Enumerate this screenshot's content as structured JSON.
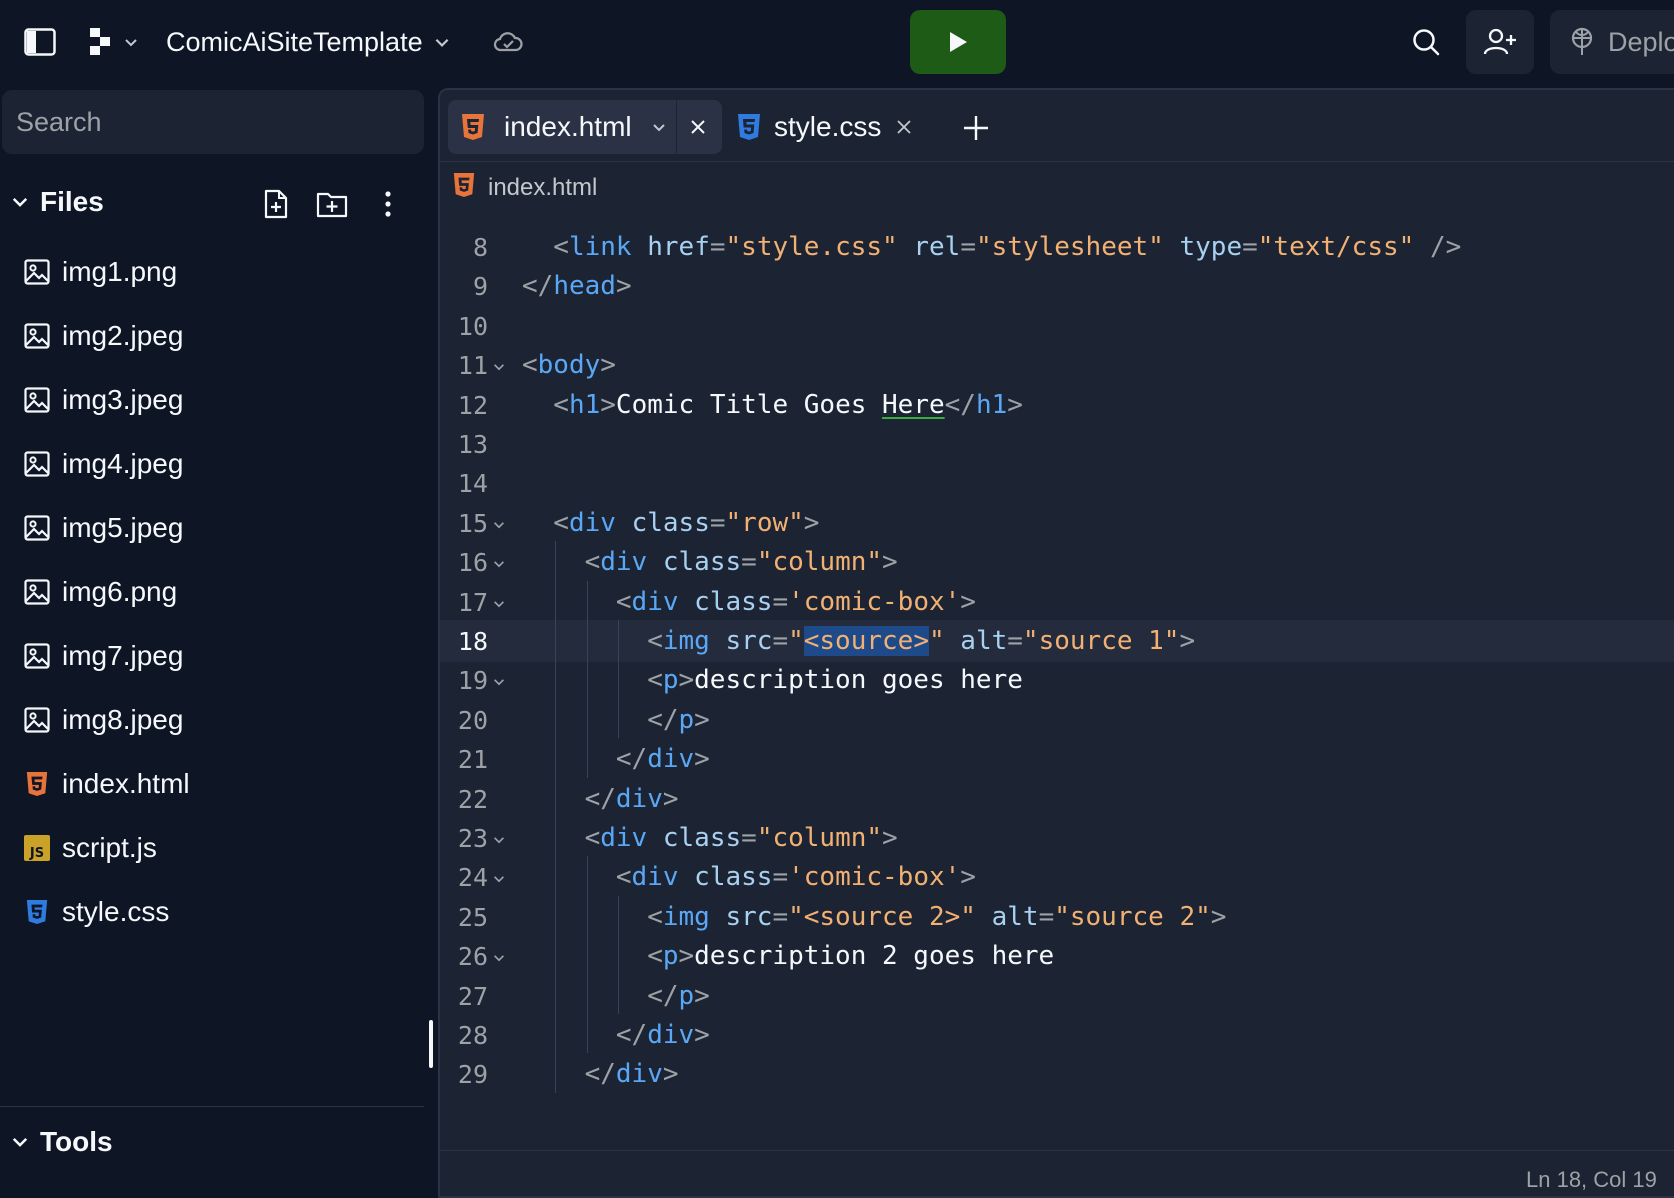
{
  "topbar": {
    "repl_name": "ComicAiSiteTemplate",
    "deploy_label": "Deploy"
  },
  "sidebar": {
    "search_placeholder": "Search",
    "files_title": "Files",
    "files": [
      {
        "name": "img1.png",
        "icon": "image-icon"
      },
      {
        "name": "img2.jpeg",
        "icon": "image-icon"
      },
      {
        "name": "img3.jpeg",
        "icon": "image-icon"
      },
      {
        "name": "img4.jpeg",
        "icon": "image-icon"
      },
      {
        "name": "img5.jpeg",
        "icon": "image-icon"
      },
      {
        "name": "img6.png",
        "icon": "image-icon"
      },
      {
        "name": "img7.jpeg",
        "icon": "image-icon"
      },
      {
        "name": "img8.jpeg",
        "icon": "image-icon"
      },
      {
        "name": "index.html",
        "icon": "html5-icon"
      },
      {
        "name": "script.js",
        "icon": "js-icon"
      },
      {
        "name": "style.css",
        "icon": "css3-icon"
      }
    ],
    "tools_title": "Tools"
  },
  "editor": {
    "tabs": [
      {
        "label": "index.html",
        "icon": "html5-icon",
        "active": true
      },
      {
        "label": "style.css",
        "icon": "css3-icon",
        "active": false
      }
    ],
    "filepath": "index.html",
    "current_line": 18,
    "code_lines": [
      {
        "n": "8",
        "fold": false,
        "indent": 1,
        "tokens": [
          [
            "br",
            "<"
          ],
          [
            "tag",
            "link"
          ],
          [
            "txt",
            " "
          ],
          [
            "attr",
            "href"
          ],
          [
            "br",
            "="
          ],
          [
            "str",
            "\"style.css\""
          ],
          [
            "txt",
            " "
          ],
          [
            "attr",
            "rel"
          ],
          [
            "br",
            "="
          ],
          [
            "str",
            "\"stylesheet\""
          ],
          [
            "txt",
            " "
          ],
          [
            "attr",
            "type"
          ],
          [
            "br",
            "="
          ],
          [
            "str",
            "\"text/css\""
          ],
          [
            "txt",
            " "
          ],
          [
            "br",
            "/>"
          ]
        ]
      },
      {
        "n": "9",
        "fold": false,
        "indent": 0,
        "tokens": [
          [
            "br",
            "</"
          ],
          [
            "tag",
            "head"
          ],
          [
            "br",
            ">"
          ]
        ]
      },
      {
        "n": "10",
        "fold": false,
        "indent": 0,
        "tokens": []
      },
      {
        "n": "11",
        "fold": true,
        "indent": 0,
        "tokens": [
          [
            "br",
            "<"
          ],
          [
            "tag",
            "body"
          ],
          [
            "br",
            ">"
          ]
        ]
      },
      {
        "n": "12",
        "fold": false,
        "indent": 1,
        "tokens": [
          [
            "br",
            "<"
          ],
          [
            "tag",
            "h1"
          ],
          [
            "br",
            ">"
          ],
          [
            "txt",
            "Comic Title Goes "
          ],
          [
            "sq",
            "Here"
          ],
          [
            "br",
            "</"
          ],
          [
            "tag",
            "h1"
          ],
          [
            "br",
            ">"
          ]
        ]
      },
      {
        "n": "13",
        "fold": false,
        "indent": 0,
        "tokens": []
      },
      {
        "n": "14",
        "fold": false,
        "indent": 0,
        "tokens": []
      },
      {
        "n": "15",
        "fold": true,
        "indent": 1,
        "tokens": [
          [
            "br",
            "<"
          ],
          [
            "tag",
            "div"
          ],
          [
            "txt",
            " "
          ],
          [
            "attr",
            "class"
          ],
          [
            "br",
            "="
          ],
          [
            "str",
            "\"row\""
          ],
          [
            "br",
            ">"
          ]
        ]
      },
      {
        "n": "16",
        "fold": true,
        "indent": 2,
        "tokens": [
          [
            "br",
            "<"
          ],
          [
            "tag",
            "div"
          ],
          [
            "txt",
            " "
          ],
          [
            "attr",
            "class"
          ],
          [
            "br",
            "="
          ],
          [
            "str",
            "\"column\""
          ],
          [
            "br",
            ">"
          ]
        ]
      },
      {
        "n": "17",
        "fold": true,
        "indent": 3,
        "tokens": [
          [
            "br",
            "<"
          ],
          [
            "tag",
            "div"
          ],
          [
            "txt",
            " "
          ],
          [
            "attr",
            "class"
          ],
          [
            "br",
            "="
          ],
          [
            "str",
            "'comic-box'"
          ],
          [
            "br",
            ">"
          ]
        ]
      },
      {
        "n": "18",
        "fold": false,
        "indent": 4,
        "tokens": [
          [
            "br",
            "<"
          ],
          [
            "tag",
            "img"
          ],
          [
            "txt",
            " "
          ],
          [
            "attr",
            "src"
          ],
          [
            "br",
            "="
          ],
          [
            "str",
            "\""
          ],
          [
            "sel",
            "<source>"
          ],
          [
            "str",
            "\""
          ],
          [
            "txt",
            " "
          ],
          [
            "attr",
            "alt"
          ],
          [
            "br",
            "="
          ],
          [
            "str",
            "\"source 1\""
          ],
          [
            "br",
            ">"
          ]
        ]
      },
      {
        "n": "19",
        "fold": true,
        "indent": 4,
        "tokens": [
          [
            "br",
            "<"
          ],
          [
            "tag",
            "p"
          ],
          [
            "br",
            ">"
          ],
          [
            "txt",
            "description goes here"
          ]
        ]
      },
      {
        "n": "20",
        "fold": false,
        "indent": 4,
        "tokens": [
          [
            "br",
            "</"
          ],
          [
            "tag",
            "p"
          ],
          [
            "br",
            ">"
          ]
        ]
      },
      {
        "n": "21",
        "fold": false,
        "indent": 3,
        "tokens": [
          [
            "br",
            "</"
          ],
          [
            "tag",
            "div"
          ],
          [
            "br",
            ">"
          ]
        ]
      },
      {
        "n": "22",
        "fold": false,
        "indent": 2,
        "tokens": [
          [
            "br",
            "</"
          ],
          [
            "tag",
            "div"
          ],
          [
            "br",
            ">"
          ]
        ]
      },
      {
        "n": "23",
        "fold": true,
        "indent": 2,
        "tokens": [
          [
            "br",
            "<"
          ],
          [
            "tag",
            "div"
          ],
          [
            "txt",
            " "
          ],
          [
            "attr",
            "class"
          ],
          [
            "br",
            "="
          ],
          [
            "str",
            "\"column\""
          ],
          [
            "br",
            ">"
          ]
        ]
      },
      {
        "n": "24",
        "fold": true,
        "indent": 3,
        "tokens": [
          [
            "br",
            "<"
          ],
          [
            "tag",
            "div"
          ],
          [
            "txt",
            " "
          ],
          [
            "attr",
            "class"
          ],
          [
            "br",
            "="
          ],
          [
            "str",
            "'comic-box'"
          ],
          [
            "br",
            ">"
          ]
        ]
      },
      {
        "n": "25",
        "fold": false,
        "indent": 4,
        "tokens": [
          [
            "br",
            "<"
          ],
          [
            "tag",
            "img"
          ],
          [
            "txt",
            " "
          ],
          [
            "attr",
            "src"
          ],
          [
            "br",
            "="
          ],
          [
            "str",
            "\"<source 2>\""
          ],
          [
            "txt",
            " "
          ],
          [
            "attr",
            "alt"
          ],
          [
            "br",
            "="
          ],
          [
            "str",
            "\"source 2\""
          ],
          [
            "br",
            ">"
          ]
        ]
      },
      {
        "n": "26",
        "fold": true,
        "indent": 4,
        "tokens": [
          [
            "br",
            "<"
          ],
          [
            "tag",
            "p"
          ],
          [
            "br",
            ">"
          ],
          [
            "txt",
            "description 2 goes here"
          ]
        ]
      },
      {
        "n": "27",
        "fold": false,
        "indent": 4,
        "tokens": [
          [
            "br",
            "</"
          ],
          [
            "tag",
            "p"
          ],
          [
            "br",
            ">"
          ]
        ]
      },
      {
        "n": "28",
        "fold": false,
        "indent": 3,
        "tokens": [
          [
            "br",
            "</"
          ],
          [
            "tag",
            "div"
          ],
          [
            "br",
            ">"
          ]
        ]
      },
      {
        "n": "29",
        "fold": false,
        "indent": 2,
        "tokens": [
          [
            "br",
            "</"
          ],
          [
            "tag",
            "div"
          ],
          [
            "br",
            ">"
          ]
        ]
      }
    ],
    "status": "Ln 18, Col 19"
  },
  "colors": {
    "background": "#0e1525",
    "panel": "#1c2333",
    "run_button": "#1e5b16",
    "html_icon": "#e7743a",
    "css_icon": "#2f7be0",
    "js_icon": "#c9a227",
    "tag": "#5aa8f5",
    "string": "#f2b173",
    "attribute": "#a8d0f0"
  }
}
